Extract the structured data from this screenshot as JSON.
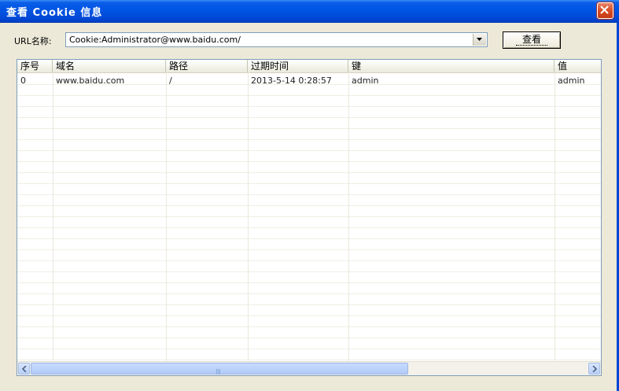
{
  "window": {
    "title": "查看 Cookie 信息"
  },
  "url_label": "URL名称:",
  "url_combo": {
    "value": "Cookie:Administrator@www.baidu.com/"
  },
  "view_button": "查看",
  "grid": {
    "columns": [
      "序号",
      "域名",
      "路径",
      "过期时间",
      "键",
      "值"
    ],
    "rows": [
      [
        "0",
        "www.baidu.com",
        "/",
        "2013-5-14 0:28:57",
        "admin",
        "admin"
      ]
    ]
  },
  "hscroll": {
    "grip": "III"
  },
  "colors": {
    "titlebar": "#0054e3",
    "window_bg": "#ece9d8",
    "close": "#d84b24"
  }
}
